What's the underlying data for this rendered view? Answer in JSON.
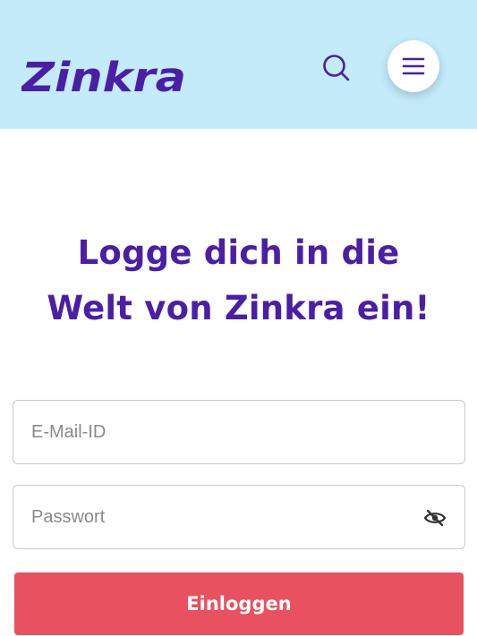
{
  "header": {
    "logo_text": "Zinkra",
    "colors": {
      "background": "#c4ebf9",
      "brand": "#4a1fa6"
    },
    "icons": {
      "search": "search-icon",
      "menu": "hamburger-menu-icon"
    }
  },
  "main": {
    "title_line1": "Logge dich in die",
    "title_line2": "Welt von Zinkra ein!",
    "email": {
      "placeholder": "E-Mail-ID",
      "value": ""
    },
    "password": {
      "placeholder": "Passwort",
      "value": "",
      "toggle_icon": "eye-slash-icon"
    },
    "login_button_label": "Einloggen",
    "colors": {
      "title": "#4a1fa6",
      "button": "#e8515f"
    }
  }
}
